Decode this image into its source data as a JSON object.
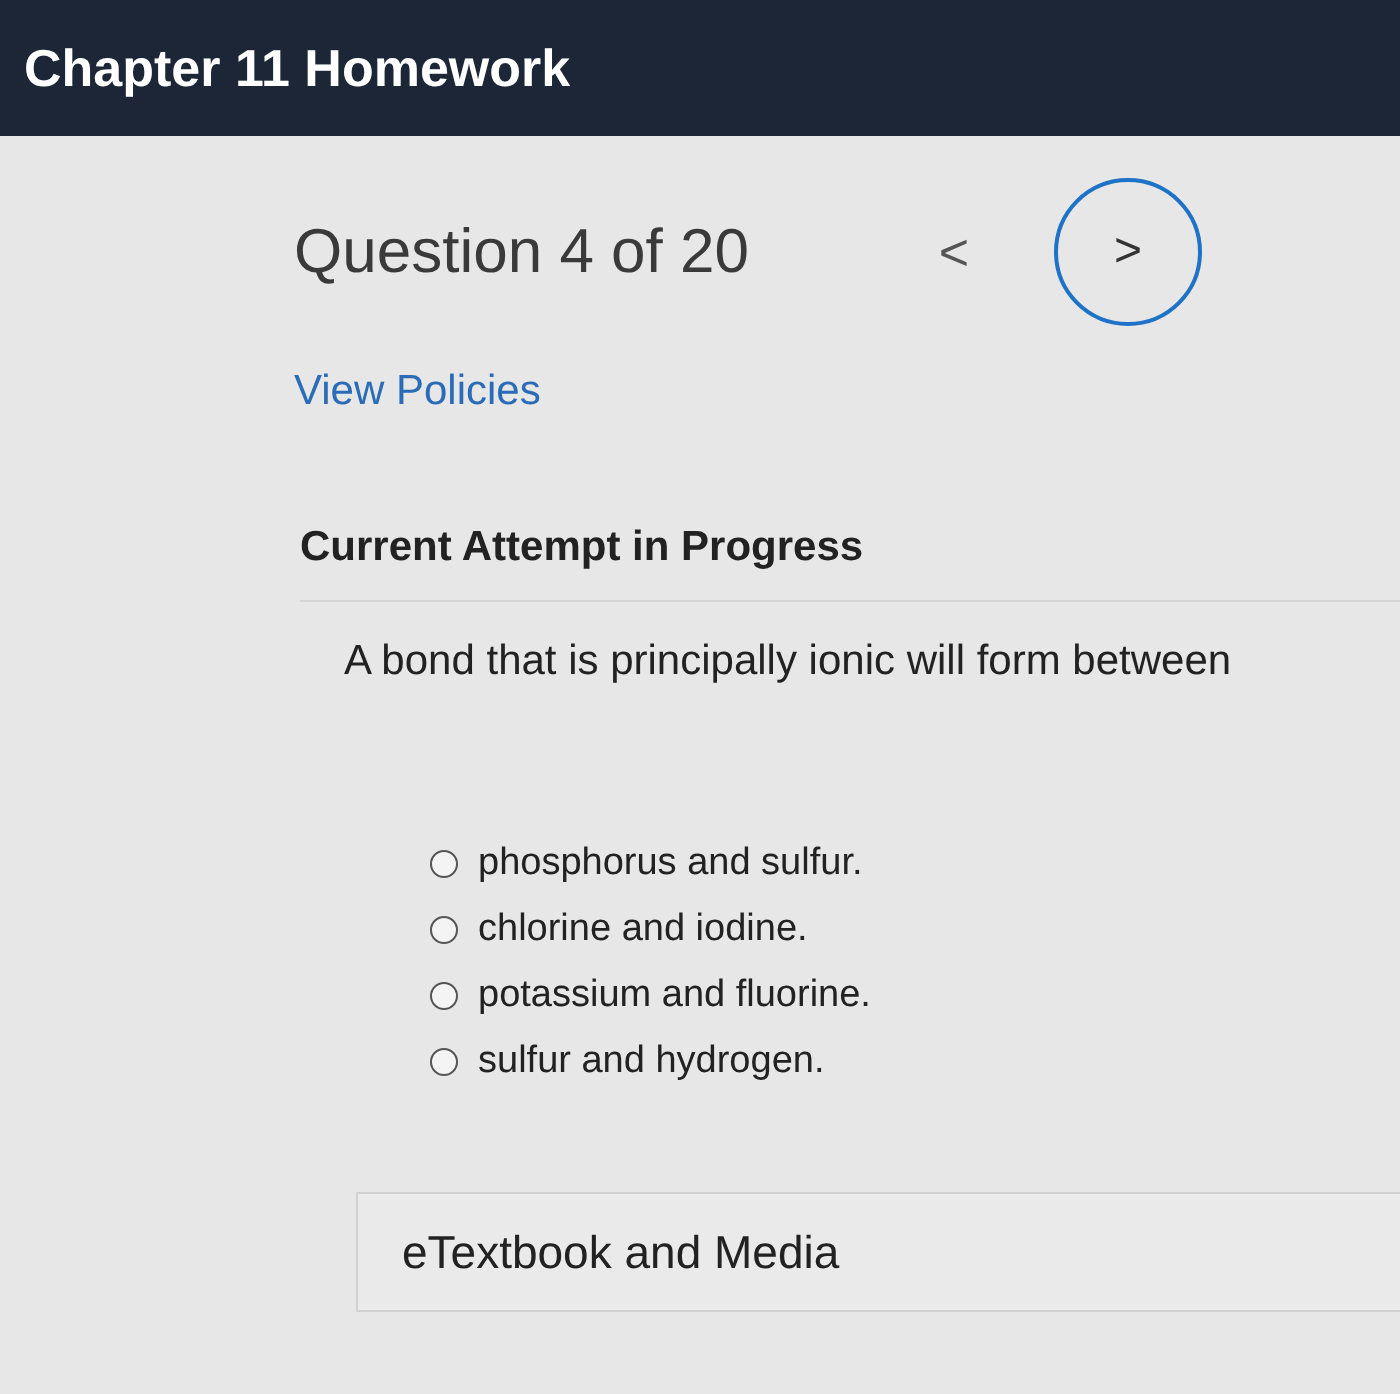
{
  "header": {
    "title": "Chapter 11 Homework"
  },
  "navigation": {
    "label": "Question 4 of 20",
    "previous": "<",
    "next": ">"
  },
  "policies_link": "View Policies",
  "attempt_heading": "Current Attempt in Progress",
  "question": "A bond that is principally ionic will form between",
  "options": [
    {
      "label": "phosphorus and sulfur.",
      "selected": false
    },
    {
      "label": "chlorine and iodine.",
      "selected": false
    },
    {
      "label": "potassium and fluorine.",
      "selected": false
    },
    {
      "label": "sulfur and hydrogen.",
      "selected": false
    }
  ],
  "resources": {
    "title": "eTextbook and Media"
  }
}
